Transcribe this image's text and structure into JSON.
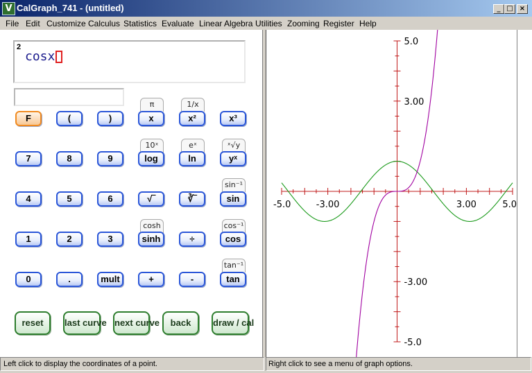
{
  "window": {
    "title": "CalGraph_741 - (untitled)",
    "app_icon": "V",
    "minimize_glyph": "_",
    "maximize_glyph": "□",
    "close_glyph": "×"
  },
  "menu": [
    "File",
    "Edit",
    "Customize",
    "Calculus",
    "Statistics",
    "Evaluate",
    "Linear Algebra",
    "Utilities",
    "Zooming",
    "Register",
    "Help"
  ],
  "expression": {
    "power": "2",
    "text": "cosx"
  },
  "keys": {
    "row1": [
      "F",
      "(",
      ")",
      "x",
      "x²",
      "x³"
    ],
    "row2": [
      "7",
      "8",
      "9",
      "log",
      "ln",
      "yˣ"
    ],
    "row3": [
      "4",
      "5",
      "6",
      "√‾",
      "∛‾",
      "sin"
    ],
    "row4": [
      "1",
      "2",
      "3",
      "sinh",
      "÷",
      "cos"
    ],
    "row5": [
      "0",
      ".",
      "mult",
      "+",
      "-",
      "tan"
    ]
  },
  "fkeys": [
    "π",
    "1/x",
    "10ˣ",
    "eˣ",
    "ˣ√y",
    "sin⁻¹",
    "cosh",
    "cos⁻¹",
    "tan⁻¹"
  ],
  "bottom_buttons": [
    "reset",
    "last curve",
    "next curve",
    "back",
    "draw / cal"
  ],
  "chart_data": {
    "type": "line",
    "xlim": [
      -5,
      5
    ],
    "ylim": [
      -5,
      5
    ],
    "x_tick_labels": [
      "-5.0",
      "-3.00",
      "3.00",
      "5.0"
    ],
    "y_tick_labels": [
      "5.0",
      "3.00",
      "-3.00",
      "-5.0"
    ],
    "series": [
      {
        "function": "cos(x)",
        "color": "#1a9a1a"
      },
      {
        "function": "x^3",
        "color": "#a000a0"
      }
    ],
    "axis_color": "#c01818",
    "grid": false
  },
  "status": {
    "left": "Left click to display the coordinates of a point.",
    "right": "Right click to see a menu of graph options."
  }
}
